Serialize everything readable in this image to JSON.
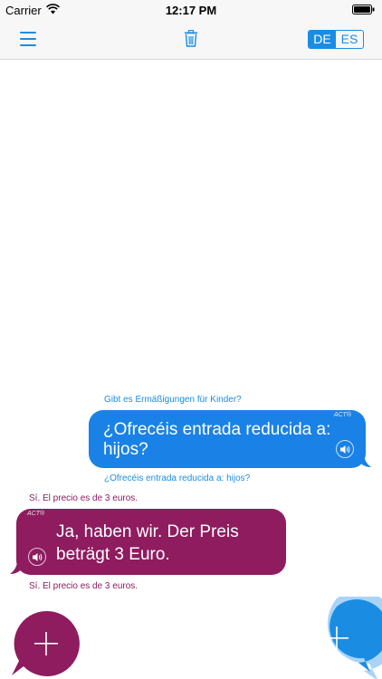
{
  "status_bar": {
    "carrier": "Carrier",
    "time": "12:17 PM"
  },
  "nav": {
    "languages": [
      "DE",
      "ES"
    ],
    "active_language": "DE"
  },
  "conversation": [
    {
      "speaker": "user",
      "caption_above": "Gibt es Ermäßigungen für Kinder?",
      "badge": "ACT®",
      "message": [
        "¿Ofrecéis entrada reducida a:",
        "hijos?"
      ],
      "caption_below": "¿Ofrecéis entrada reducida a: hijos?"
    },
    {
      "speaker": "partner",
      "caption_above": "Sí. El precio es de 3 euros.",
      "badge": "ACT®",
      "message": [
        "Ja, haben wir. Der Preis",
        "beträgt 3 Euro."
      ],
      "caption_below": "Sí. El precio es de 3 euros."
    }
  ],
  "colors": {
    "accent_blue": "#1a8de3",
    "user_bubble": "#1a82e6",
    "partner_bubble": "#8e1c5f",
    "fab_ring": "#a9d4f8"
  },
  "icons": {
    "menu": "menu-icon",
    "trash": "trash-icon",
    "speaker": "speaker-icon",
    "add": "plus-icon"
  }
}
